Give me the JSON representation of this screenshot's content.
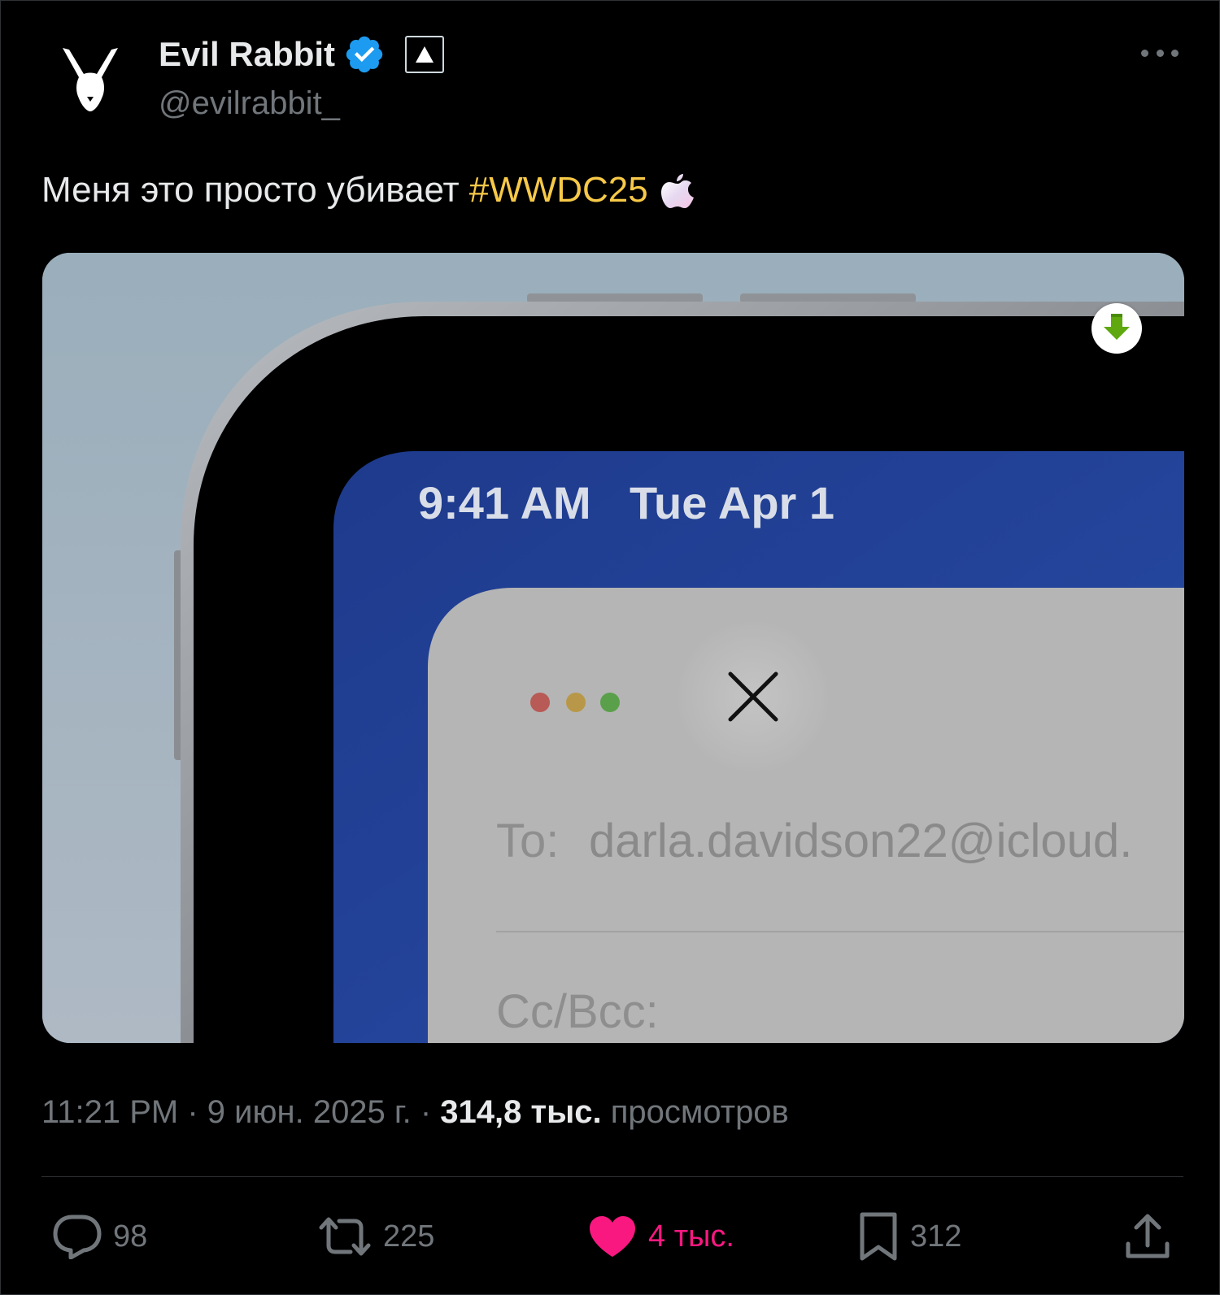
{
  "author": {
    "display_name": "Evil Rabbit",
    "handle": "@evilrabbit_",
    "verified": true,
    "affiliate_badge_icon": "triangle-logo-icon",
    "avatar_icon": "rabbit-logo-icon"
  },
  "tweet": {
    "text": "Меня это просто убивает",
    "hashtag": "#WWDC25",
    "emoji_icon": "apple-logo-icon"
  },
  "media": {
    "status_time": "9:41 AM",
    "status_date": "Tue Apr 1",
    "mail_to_label": "To:",
    "mail_to_value": "darla.davidson22@icloud.",
    "mail_cc_label": "Cc/Bcc:",
    "download_icon": "download-arrow-icon"
  },
  "meta": {
    "time": "11:21 PM",
    "sep1": " · ",
    "date": "9 июн. 2025 г.",
    "sep2": " · ",
    "views_count": "314,8 тыс.",
    "views_label": " просмотров"
  },
  "actions": {
    "replies": "98",
    "reposts": "225",
    "likes": "4 тыс.",
    "bookmarks": "312"
  },
  "colors": {
    "background": "#000000",
    "hashtag": "#f7c948",
    "like": "#f91880",
    "verified": "#1d9bf0",
    "muted": "#71767b"
  }
}
